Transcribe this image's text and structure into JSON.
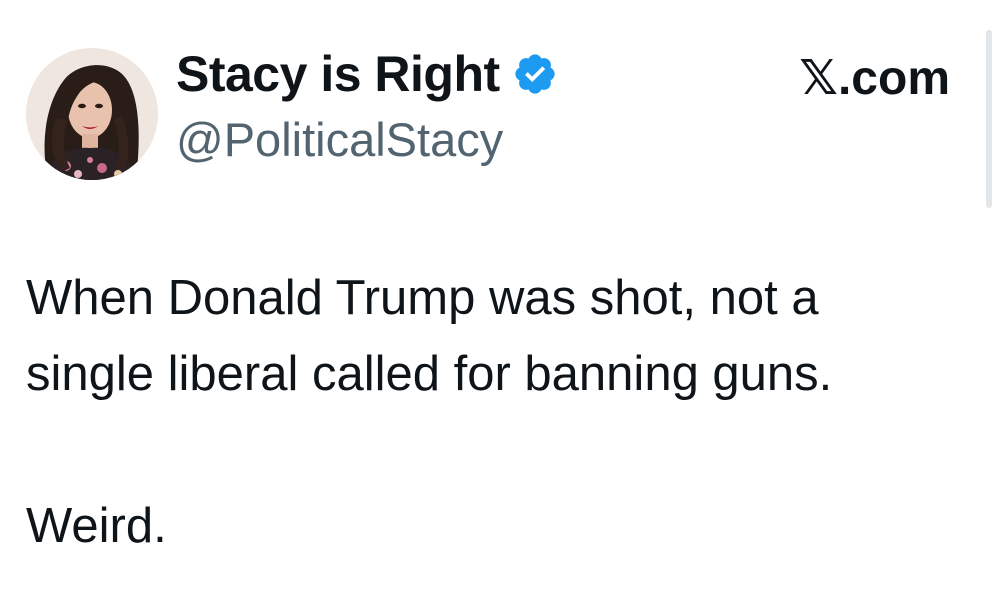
{
  "author": {
    "display_name": "Stacy is Right",
    "handle": "@PoliticalStacy",
    "verified": true,
    "badge_color": "#1d9bf0"
  },
  "source": {
    "label": "X.com",
    "logo_glyph": "𝕏",
    "suffix": ".com"
  },
  "tweet": {
    "line1": "When Donald Trump was shot, not a",
    "line2": "single liberal called for banning guns.",
    "line3": "Weird."
  },
  "icons": {
    "avatar": "profile-photo",
    "verified": "verified-check-icon",
    "logo": "x-logo-icon"
  }
}
